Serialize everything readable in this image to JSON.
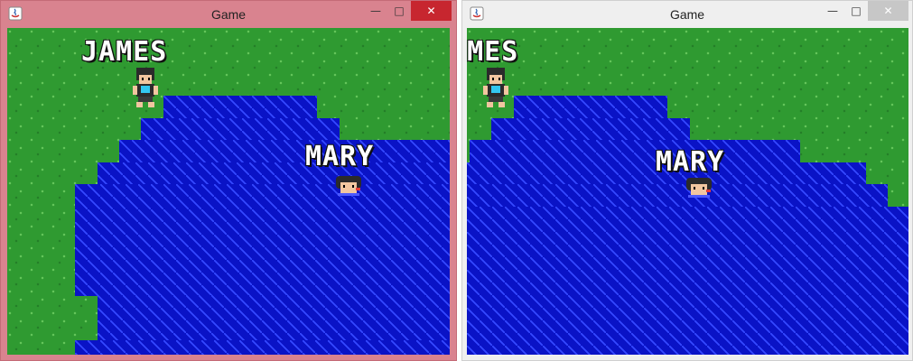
{
  "windows": [
    {
      "title": "Game",
      "icons": {
        "app": "java-icon",
        "minimize": "minimize-icon",
        "maximize": "maximize-icon",
        "close": "close-icon"
      },
      "active": true,
      "players": {
        "james": "JAMES",
        "mary": "MARY"
      }
    },
    {
      "title": "Game",
      "icons": {
        "app": "java-icon",
        "minimize": "minimize-icon",
        "maximize": "maximize-icon",
        "close": "close-icon"
      },
      "active": false,
      "players": {
        "james": "JAMES",
        "mary": "MARY"
      }
    }
  ],
  "glyphs": {
    "minimize": "—",
    "maximize": "□",
    "close": "✕"
  },
  "colors": {
    "grass": "#2f9a31",
    "water": "#0a13c6",
    "active_frame": "#d9838f",
    "close_active": "#c7262f"
  }
}
